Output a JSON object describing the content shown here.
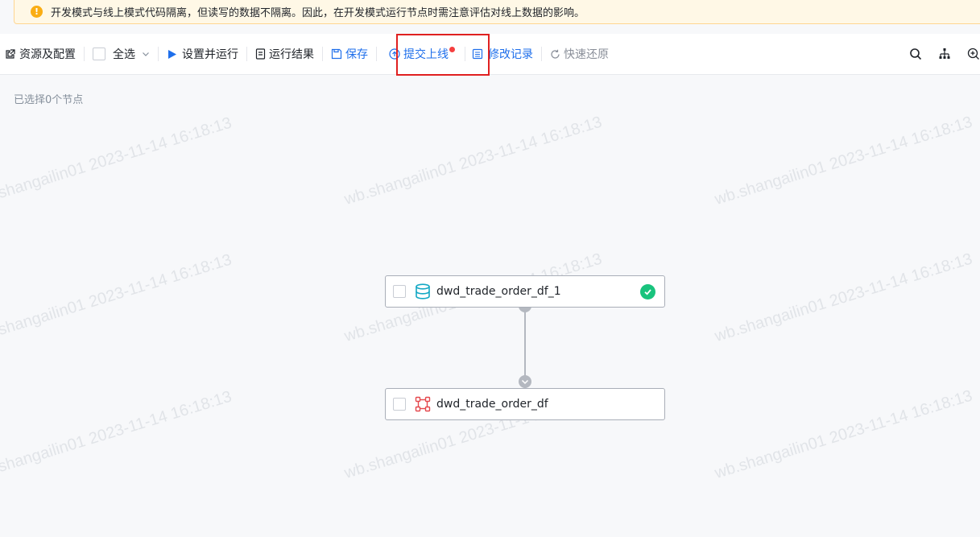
{
  "notice": {
    "icon": "warning-icon",
    "text": "开发模式与线上模式代码隔离，但读写的数据不隔离。因此，在开发模式运行节点时需注意评估对线上数据的影响。"
  },
  "toolbar": {
    "resources_label": "资源及配置",
    "select_all_label": "全选",
    "set_and_run_label": "设置并运行",
    "run_results_label": "运行结果",
    "save_label": "保存",
    "submit_online_label": "提交上线",
    "change_log_label": "修改记录",
    "quick_restore_label": "快速还原"
  },
  "canvas": {
    "selected_text": "已选择0个节点",
    "nodes": [
      {
        "label": "dwd_trade_order_df_1",
        "icon": "database-icon",
        "status": "success"
      },
      {
        "label": "dwd_trade_order_df",
        "icon": "table-node-icon"
      }
    ]
  },
  "watermark": {
    "text_a": "wb.shangailin01 2023-11-14 16:18:13",
    "text_b": "shangailin01 2023-11-14 16:18:13"
  },
  "colors": {
    "accent": "#1f6feb",
    "success": "#19c37d",
    "highlight": "#e02020",
    "warning": "#faad14"
  }
}
